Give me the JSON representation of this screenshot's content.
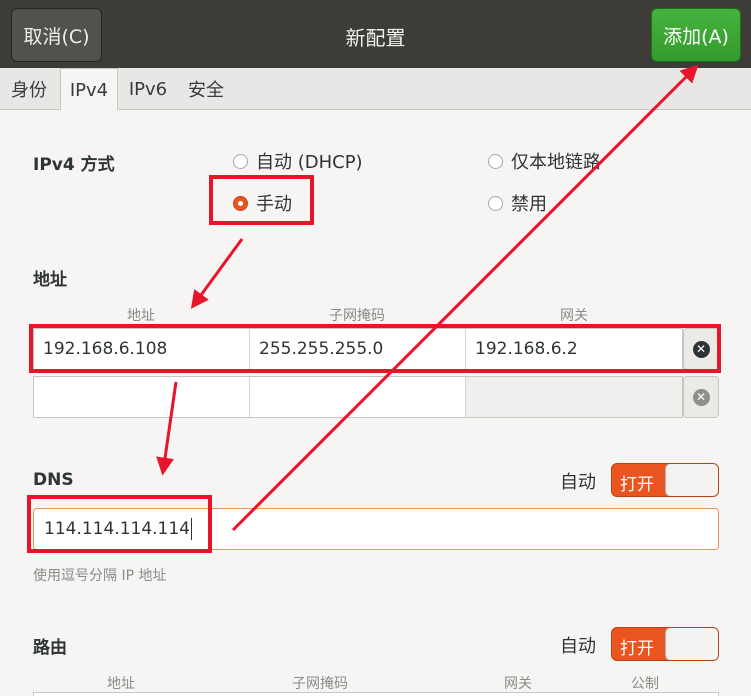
{
  "header": {
    "cancel_label": "取消(C)",
    "title": "新配置",
    "add_label": "添加(A)"
  },
  "tabs": [
    {
      "label": "身份"
    },
    {
      "label": "IPv4"
    },
    {
      "label": "IPv6"
    },
    {
      "label": "安全"
    }
  ],
  "ipv4": {
    "method_label": "IPv4 方式",
    "options": {
      "auto_dhcp": "自动 (DHCP)",
      "link_local": "仅本地链路",
      "manual": "手动",
      "disabled": "禁用"
    },
    "selected": "manual"
  },
  "addresses": {
    "section_label": "地址",
    "columns": [
      "地址",
      "子网掩码",
      "网关"
    ],
    "rows": [
      {
        "address": "192.168.6.108",
        "netmask": "255.255.255.0",
        "gateway": "192.168.6.2"
      }
    ]
  },
  "dns": {
    "label": "DNS",
    "auto_label": "自动",
    "switch_label": "打开",
    "value": "114.114.114.114",
    "hint": "使用逗号分隔 IP 地址"
  },
  "routes": {
    "label": "路由",
    "auto_label": "自动",
    "switch_label": "打开",
    "columns": [
      "地址",
      "子网掩码",
      "网关",
      "公制"
    ]
  },
  "colors": {
    "accent": "#e9541f",
    "annotation": "#e8142a",
    "add_button": "#3aa633"
  }
}
